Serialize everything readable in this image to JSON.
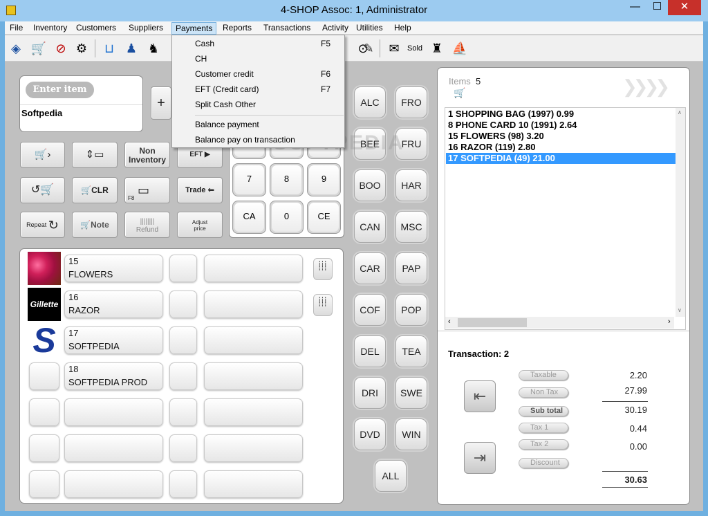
{
  "window": {
    "title": "4-SHOP   Assoc: 1, Administrator",
    "min": "—",
    "max": "☐",
    "close": "✕"
  },
  "menubar": [
    "File",
    "Inventory",
    "Customers",
    "Suppliers",
    "Payments",
    "Reports",
    "Transactions",
    "Activity",
    "Utilities",
    "Help"
  ],
  "payments_menu": {
    "items": [
      {
        "label": "Cash",
        "key": "F5"
      },
      {
        "label": "CH",
        "key": ""
      },
      {
        "label": "Customer credit",
        "key": "F6"
      },
      {
        "label": "EFT (Credit card)",
        "key": "F7"
      },
      {
        "label": "Split Cash Other",
        "key": ""
      },
      {
        "label": "Balance payment",
        "key": ""
      },
      {
        "label": "Balance pay on transaction",
        "key": ""
      }
    ]
  },
  "enter_item": {
    "button": "Enter item",
    "value": "Softpedia"
  },
  "buttons": {
    "non_inventory": "Non\nInventory",
    "eft": "EFT",
    "clr": "CLR",
    "trade": "Trade",
    "repeat": "Repeat",
    "note": "Note",
    "refund": "Refund",
    "adjust_price": "Adjust\nprice",
    "f8": "F8"
  },
  "keypad": [
    "7",
    "8",
    "9",
    "CA",
    "0",
    "CE"
  ],
  "departments": [
    [
      "ALC",
      "FRO"
    ],
    [
      "BEE",
      "FRU"
    ],
    [
      "BOO",
      "HAR"
    ],
    [
      "CAN",
      "MSC"
    ],
    [
      "CAR",
      "PAP"
    ],
    [
      "COF",
      "POP"
    ],
    [
      "DEL",
      "TEA"
    ],
    [
      "DRI",
      "SWE"
    ],
    [
      "DVD",
      "WIN"
    ]
  ],
  "dept_all": "ALL",
  "products": [
    {
      "id": "15",
      "name": "FLOWERS"
    },
    {
      "id": "16",
      "name": "RAZOR"
    },
    {
      "id": "17",
      "name": "SOFTPEDIA"
    },
    {
      "id": "18",
      "name": "SOFTPEDIA PROD"
    }
  ],
  "gillette_logo": "Gillette",
  "items_panel": {
    "label": "Items",
    "count": "5",
    "rows": [
      "1  SHOPPING BAG (1997)  0.99",
      "8  PHONE CARD 10 (1991)  2.64",
      "15  FLOWERS (98)  3.20",
      "16  RAZOR (119)  2.80",
      "17  SOFTPEDIA (49)  21.00"
    ],
    "selected_index": 4
  },
  "transaction": {
    "label": "Transaction: 2",
    "lines": [
      {
        "label": "Taxable",
        "value": "2.20"
      },
      {
        "label": "Non Tax",
        "value": "27.99"
      },
      {
        "label": "Sub total",
        "value": "30.19"
      },
      {
        "label": "Tax 1",
        "value": "0.44"
      },
      {
        "label": "Tax 2",
        "value": "0.00"
      },
      {
        "label": "Discount",
        "value": ""
      }
    ],
    "total": "30.63"
  },
  "watermark": "SOFTPEDIA",
  "colors": {
    "selection": "#3399ff",
    "titlebar": "#9ccbf0",
    "close": "#c7302a"
  }
}
